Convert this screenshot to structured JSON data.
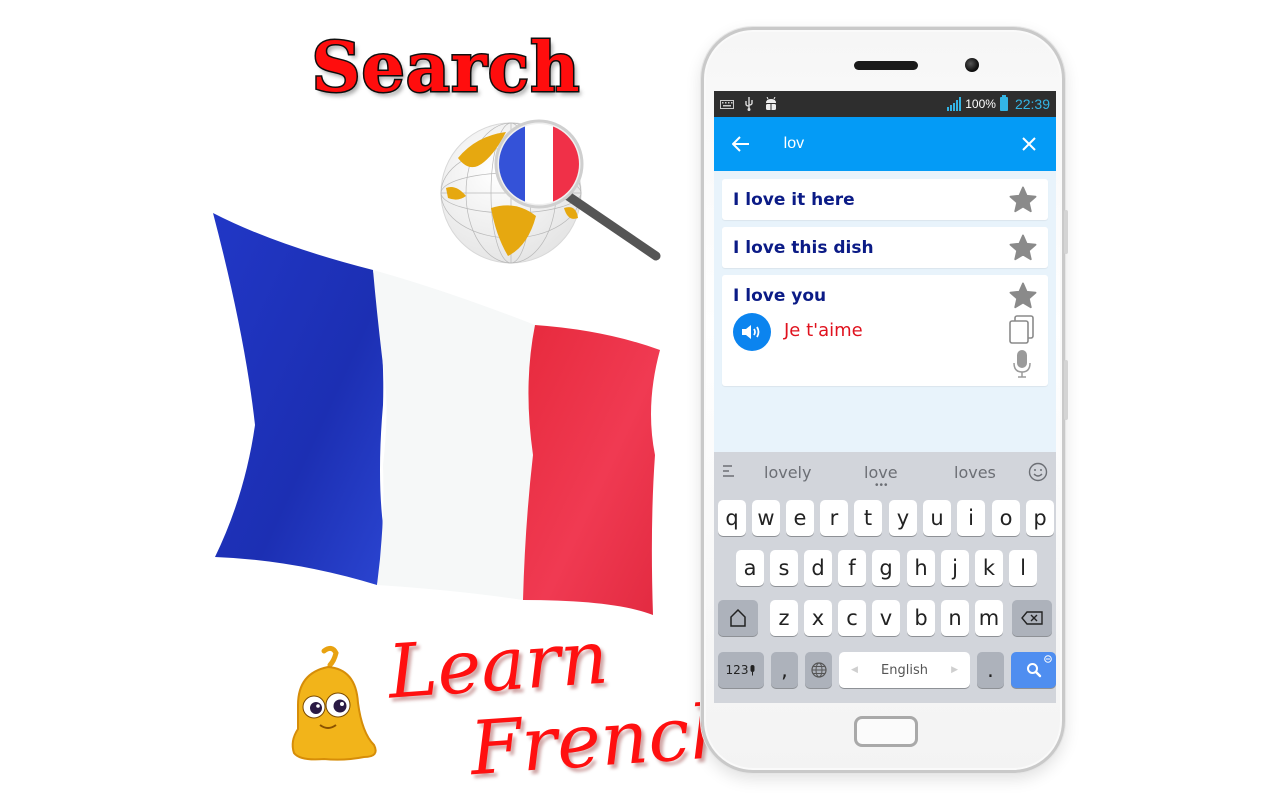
{
  "promo": {
    "title": "Search",
    "tagline_line1": "Learn",
    "tagline_line2": "French",
    "flag_colors": {
      "blue": "#2036c3",
      "white": "#f7f9f9",
      "red": "#ee3048"
    },
    "globe_accent": "#e6a810"
  },
  "status_bar": {
    "left_icons": [
      "keyboard-icon",
      "usb-icon",
      "android-debug-icon"
    ],
    "battery_percent": "100%",
    "time": "22:39"
  },
  "app_bar": {
    "back_icon": "arrow-left-icon",
    "search_value": "lov",
    "clear_icon": "close-icon",
    "color": "#049bf6"
  },
  "results": [
    {
      "phrase": "I love it here",
      "favorite": false
    },
    {
      "phrase": "I love this dish",
      "favorite": false
    },
    {
      "phrase": "I love you",
      "translation": "Je t'aime",
      "favorite": false,
      "expanded": true
    }
  ],
  "keyboard": {
    "suggestions": [
      "lovely",
      "love",
      "loves"
    ],
    "row1": [
      "q",
      "w",
      "e",
      "r",
      "t",
      "y",
      "u",
      "i",
      "o",
      "p"
    ],
    "row2": [
      "a",
      "s",
      "d",
      "f",
      "g",
      "h",
      "j",
      "k",
      "l"
    ],
    "row3": [
      "z",
      "x",
      "c",
      "v",
      "b",
      "n",
      "m"
    ],
    "numbers_label": "123",
    "comma": ",",
    "space_label": "English",
    "period": ".",
    "action_icon": "search-icon"
  }
}
